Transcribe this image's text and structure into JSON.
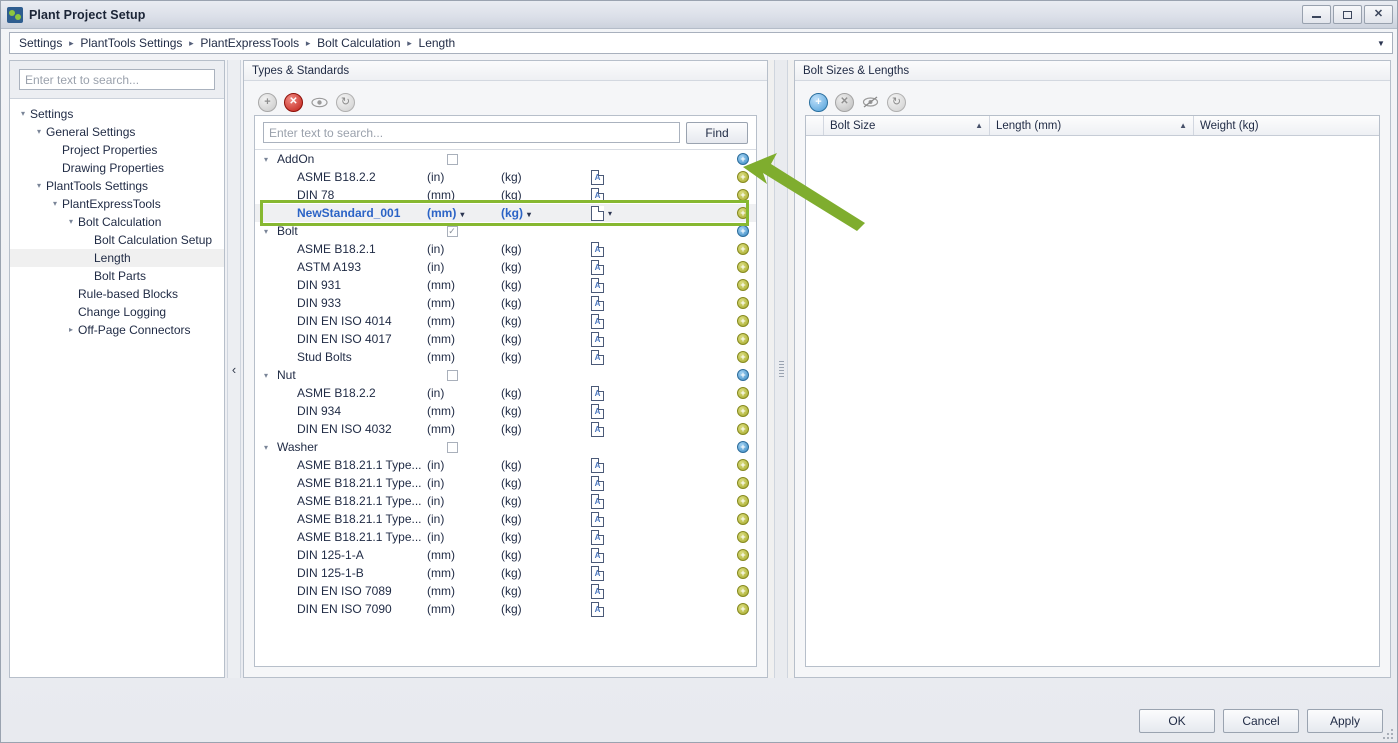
{
  "window": {
    "title": "Plant Project Setup",
    "app_icon": "plant-project-icon",
    "controls": {
      "minimize": "minimize-icon",
      "maximize": "maximize-icon",
      "close": "close-icon"
    }
  },
  "breadcrumb": {
    "items": [
      "Settings",
      "PlantTools Settings",
      "PlantExpressTools",
      "Bolt Calculation",
      "Length"
    ],
    "separator": "▸",
    "dropdown": "▼"
  },
  "sidebar": {
    "search": {
      "placeholder": "Enter text to search...",
      "value": ""
    },
    "items": [
      {
        "label": "Settings",
        "depth": 0,
        "twisty": "▾",
        "selected": false
      },
      {
        "label": "General Settings",
        "depth": 1,
        "twisty": "▾",
        "selected": false
      },
      {
        "label": "Project Properties",
        "depth": 2,
        "twisty": "",
        "selected": false
      },
      {
        "label": "Drawing Properties",
        "depth": 2,
        "twisty": "",
        "selected": false
      },
      {
        "label": "PlantTools Settings",
        "depth": 1,
        "twisty": "▾",
        "selected": false
      },
      {
        "label": "PlantExpressTools",
        "depth": 2,
        "twisty": "▾",
        "selected": false
      },
      {
        "label": "Bolt Calculation",
        "depth": 3,
        "twisty": "▾",
        "selected": false
      },
      {
        "label": "Bolt Calculation Setup",
        "depth": 4,
        "twisty": "",
        "selected": false
      },
      {
        "label": "Length",
        "depth": 4,
        "twisty": "",
        "selected": true
      },
      {
        "label": "Bolt Parts",
        "depth": 4,
        "twisty": "",
        "selected": false
      },
      {
        "label": "Rule-based Blocks",
        "depth": 3,
        "twisty": "",
        "selected": false
      },
      {
        "label": "Change Logging",
        "depth": 3,
        "twisty": "",
        "selected": false
      },
      {
        "label": "Off-Page Connectors",
        "depth": 3,
        "twisty": "▸",
        "selected": false
      }
    ]
  },
  "collapse_handle": {
    "glyph": "‹"
  },
  "types_panel": {
    "caption": "Types & Standards",
    "toolbar": [
      {
        "name": "add-type-button",
        "icon": "plus-icon",
        "state": "disabled",
        "glyph": "+"
      },
      {
        "name": "delete-type-button",
        "icon": "delete-x-icon",
        "state": "enabled",
        "glyph": "✕"
      },
      {
        "name": "visibility-button",
        "icon": "eye-icon",
        "state": "disabled",
        "glyph": ""
      },
      {
        "name": "refresh-button",
        "icon": "refresh-icon",
        "state": "disabled",
        "glyph": "↻"
      }
    ],
    "find": {
      "placeholder": "Enter text to search...",
      "value": "",
      "button_label": "Find"
    },
    "rows": [
      {
        "kind": "group",
        "name": "AddOn",
        "twisty": "▾",
        "checkbox": "unchecked",
        "add_icon": "add-standard-icon",
        "add_color": "blue"
      },
      {
        "kind": "child",
        "name": "ASME B18.2.2",
        "unit": "(in)",
        "weight_unit": "(kg)",
        "doc": "A",
        "add_color": "olive"
      },
      {
        "kind": "child",
        "name": "DIN 78",
        "unit": "(mm)",
        "weight_unit": "(kg)",
        "doc": "A",
        "add_color": "olive"
      },
      {
        "kind": "editing",
        "name": "NewStandard_001",
        "unit": "(mm)",
        "weight_unit": "(kg)",
        "doc": "",
        "add_color": "olive",
        "caret": "▾"
      },
      {
        "kind": "group",
        "name": "Bolt",
        "twisty": "▾",
        "checkbox": "checked",
        "add_icon": "add-standard-icon",
        "add_color": "blue"
      },
      {
        "kind": "child",
        "name": "ASME B18.2.1",
        "unit": "(in)",
        "weight_unit": "(kg)",
        "doc": "A",
        "add_color": "olive"
      },
      {
        "kind": "child",
        "name": "ASTM A193",
        "unit": "(in)",
        "weight_unit": "(kg)",
        "doc": "A",
        "add_color": "olive"
      },
      {
        "kind": "child",
        "name": "DIN 931",
        "unit": "(mm)",
        "weight_unit": "(kg)",
        "doc": "A",
        "add_color": "olive"
      },
      {
        "kind": "child",
        "name": "DIN 933",
        "unit": "(mm)",
        "weight_unit": "(kg)",
        "doc": "A",
        "add_color": "olive"
      },
      {
        "kind": "child",
        "name": "DIN EN ISO 4014",
        "unit": "(mm)",
        "weight_unit": "(kg)",
        "doc": "A",
        "add_color": "olive"
      },
      {
        "kind": "child",
        "name": "DIN EN ISO 4017",
        "unit": "(mm)",
        "weight_unit": "(kg)",
        "doc": "A",
        "add_color": "olive"
      },
      {
        "kind": "child",
        "name": "Stud Bolts",
        "unit": "(mm)",
        "weight_unit": "(kg)",
        "doc": "A",
        "add_color": "olive"
      },
      {
        "kind": "group",
        "name": "Nut",
        "twisty": "▾",
        "checkbox": "unchecked",
        "add_icon": "add-standard-icon",
        "add_color": "blue"
      },
      {
        "kind": "child",
        "name": "ASME B18.2.2",
        "unit": "(in)",
        "weight_unit": "(kg)",
        "doc": "A",
        "add_color": "olive"
      },
      {
        "kind": "child",
        "name": "DIN 934",
        "unit": "(mm)",
        "weight_unit": "(kg)",
        "doc": "A",
        "add_color": "olive"
      },
      {
        "kind": "child",
        "name": "DIN EN ISO 4032",
        "unit": "(mm)",
        "weight_unit": "(kg)",
        "doc": "A",
        "add_color": "olive"
      },
      {
        "kind": "group",
        "name": "Washer",
        "twisty": "▾",
        "checkbox": "unchecked",
        "add_icon": "add-standard-icon",
        "add_color": "blue"
      },
      {
        "kind": "child",
        "name": "ASME B18.21.1 Type...",
        "unit": "(in)",
        "weight_unit": "(kg)",
        "doc": "A",
        "add_color": "olive"
      },
      {
        "kind": "child",
        "name": "ASME B18.21.1 Type...",
        "unit": "(in)",
        "weight_unit": "(kg)",
        "doc": "A",
        "add_color": "olive"
      },
      {
        "kind": "child",
        "name": "ASME B18.21.1 Type...",
        "unit": "(in)",
        "weight_unit": "(kg)",
        "doc": "A",
        "add_color": "olive"
      },
      {
        "kind": "child",
        "name": "ASME B18.21.1 Type...",
        "unit": "(in)",
        "weight_unit": "(kg)",
        "doc": "A",
        "add_color": "olive"
      },
      {
        "kind": "child",
        "name": "ASME B18.21.1 Type...",
        "unit": "(in)",
        "weight_unit": "(kg)",
        "doc": "A",
        "add_color": "olive"
      },
      {
        "kind": "child",
        "name": "DIN 125-1-A",
        "unit": "(mm)",
        "weight_unit": "(kg)",
        "doc": "A",
        "add_color": "olive"
      },
      {
        "kind": "child",
        "name": "DIN 125-1-B",
        "unit": "(mm)",
        "weight_unit": "(kg)",
        "doc": "A",
        "add_color": "olive"
      },
      {
        "kind": "child",
        "name": "DIN EN ISO 7089",
        "unit": "(mm)",
        "weight_unit": "(kg)",
        "doc": "A",
        "add_color": "olive"
      },
      {
        "kind": "child",
        "name": "DIN EN ISO 7090",
        "unit": "(mm)",
        "weight_unit": "(kg)",
        "doc": "A",
        "add_color": "olive"
      }
    ]
  },
  "sizes_panel": {
    "caption": "Bolt Sizes & Lengths",
    "toolbar": [
      {
        "name": "add-size-button",
        "icon": "plus-icon",
        "state": "enabled",
        "glyph": "+"
      },
      {
        "name": "delete-size-button",
        "icon": "delete-x-icon",
        "state": "disabled",
        "glyph": "✕"
      },
      {
        "name": "visibility-button",
        "icon": "eye-off-icon",
        "state": "disabled",
        "glyph": ""
      },
      {
        "name": "refresh-button",
        "icon": "refresh-icon",
        "state": "disabled",
        "glyph": "↻"
      }
    ],
    "columns": [
      {
        "label": "Bolt Size",
        "sort": "▲"
      },
      {
        "label": "Length (mm)",
        "sort": "▲"
      },
      {
        "label": "Weight (kg)",
        "sort": ""
      }
    ],
    "rows": []
  },
  "splitter": {
    "name": "panel-splitter"
  },
  "footer": {
    "ok": "OK",
    "cancel": "Cancel",
    "apply": "Apply"
  },
  "annotation": {
    "highlight_color": "#87b831",
    "arrow_color": "#7fad2e",
    "target": "add-standard-icon-addon"
  }
}
